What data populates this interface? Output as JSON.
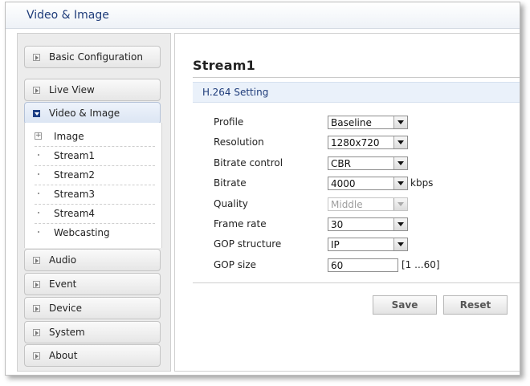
{
  "app": {
    "title": "Video & Image"
  },
  "sidebar": {
    "items": [
      {
        "label": "Basic Configuration"
      },
      {
        "label": "Live View"
      },
      {
        "label": "Video & Image"
      },
      {
        "label": "Audio"
      },
      {
        "label": "Event"
      },
      {
        "label": "Device"
      },
      {
        "label": "System"
      },
      {
        "label": "About"
      }
    ],
    "active": "Video & Image",
    "submenu": [
      {
        "label": "Image"
      },
      {
        "label": "Stream1"
      },
      {
        "label": "Stream2"
      },
      {
        "label": "Stream3"
      },
      {
        "label": "Stream4"
      },
      {
        "label": "Webcasting"
      }
    ]
  },
  "main": {
    "title": "Stream1",
    "section": "H.264 Setting",
    "fields": {
      "profile": {
        "label": "Profile",
        "value": "Baseline"
      },
      "resolution": {
        "label": "Resolution",
        "value": "1280x720"
      },
      "bitrate_control": {
        "label": "Bitrate control",
        "value": "CBR"
      },
      "bitrate": {
        "label": "Bitrate",
        "value": "4000",
        "unit": "kbps"
      },
      "quality": {
        "label": "Quality",
        "value": "Middle"
      },
      "frame_rate": {
        "label": "Frame rate",
        "value": "30"
      },
      "gop_structure": {
        "label": "GOP structure",
        "value": "IP"
      },
      "gop_size": {
        "label": "GOP size",
        "value": "60",
        "range": "[1 ...60]"
      }
    },
    "buttons": {
      "save": "Save",
      "reset": "Reset"
    }
  },
  "colors": {
    "accent": "#1f3c7a",
    "section_bg": "#eaf1fa"
  }
}
